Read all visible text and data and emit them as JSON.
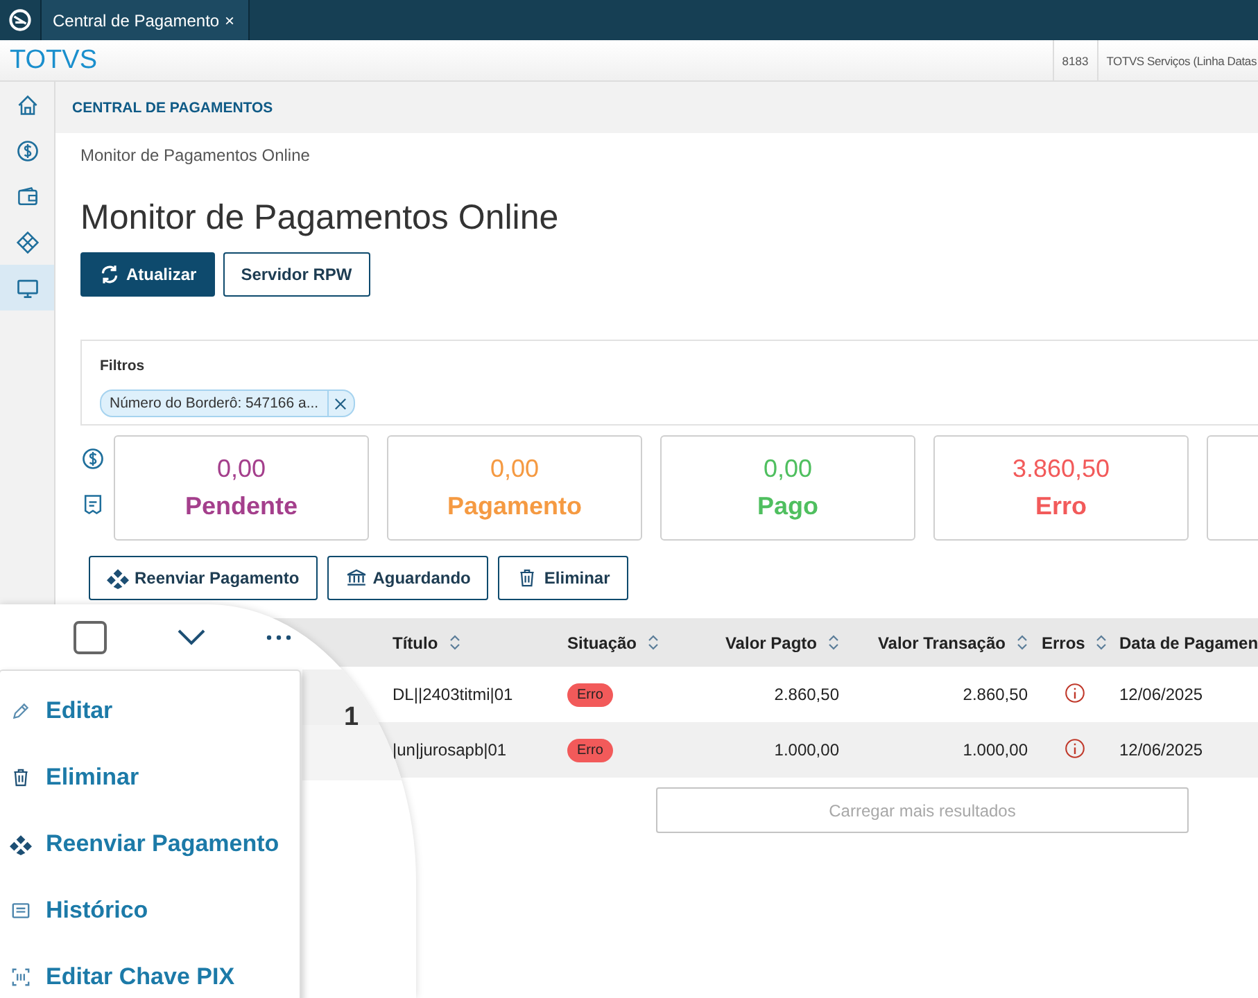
{
  "window": {
    "tab": {
      "title": "Central de Pagamento",
      "close": "×"
    }
  },
  "header": {
    "brand": "TOTVS",
    "code": "8183",
    "company": "TOTVS Serviços (Linha Datas"
  },
  "sidebar": {
    "items": [
      {
        "kind": "home",
        "selected": false
      },
      {
        "kind": "dollar",
        "selected": false
      },
      {
        "kind": "wallet",
        "selected": false
      },
      {
        "kind": "diamond",
        "selected": false
      },
      {
        "kind": "monitor",
        "selected": true
      }
    ]
  },
  "section": {
    "title": "CENTRAL DE PAGAMENTOS"
  },
  "breadcrumb": "Monitor de Pagamentos Online",
  "page_title": "Monitor de Pagamentos Online",
  "buttons": [
    {
      "label": "Atualizar",
      "kind": "primary"
    },
    {
      "label": "Servidor RPW",
      "kind": "outline"
    }
  ],
  "filters": {
    "title": "Filtros",
    "chips": [
      {
        "label": "Número do Borderô: 547166 a..."
      }
    ]
  },
  "totals": [
    {
      "value": "0,00",
      "label": "Pendente",
      "color": "#a43f8c"
    },
    {
      "value": "0,00",
      "label": "Pagamento",
      "color": "#f59a42"
    },
    {
      "value": "0,00",
      "label": "Pago",
      "color": "#4fbf5f"
    },
    {
      "value": "3.860,50",
      "label": "Erro",
      "color": "#f25a5a"
    }
  ],
  "actions": [
    {
      "label": "Reenviar Pagamento",
      "kind": "resend"
    },
    {
      "label": "Aguardando",
      "kind": "bank"
    },
    {
      "label": "Eliminar",
      "kind": "trash"
    }
  ],
  "table": {
    "columns": [
      "Título",
      "Situação",
      "Valor Pagto",
      "Valor Transação",
      "Erros",
      "Data de Pagamen"
    ],
    "rows": [
      {
        "titulo": "DL||2403titmi|01",
        "situacao": "Erro",
        "valor_pagto": "2.860,50",
        "valor_transacao": "2.860,50",
        "data": "12/06/2025"
      },
      {
        "titulo": "|un|jurosapb|01",
        "situacao": "Erro",
        "valor_pagto": "1.000,00",
        "valor_transacao": "1.000,00",
        "data": "12/06/2025"
      }
    ],
    "load_more": "Carregar mais resultados"
  },
  "magnifier": {
    "checkbox_checked": false,
    "row_number": "1",
    "menu": [
      {
        "label": "Editar",
        "kind": "edit"
      },
      {
        "label": "Eliminar",
        "kind": "trash"
      },
      {
        "label": "Reenviar Pagamento",
        "kind": "resend"
      },
      {
        "label": "Histórico",
        "kind": "history"
      },
      {
        "label": "Editar Chave PIX",
        "kind": "pix"
      }
    ]
  }
}
